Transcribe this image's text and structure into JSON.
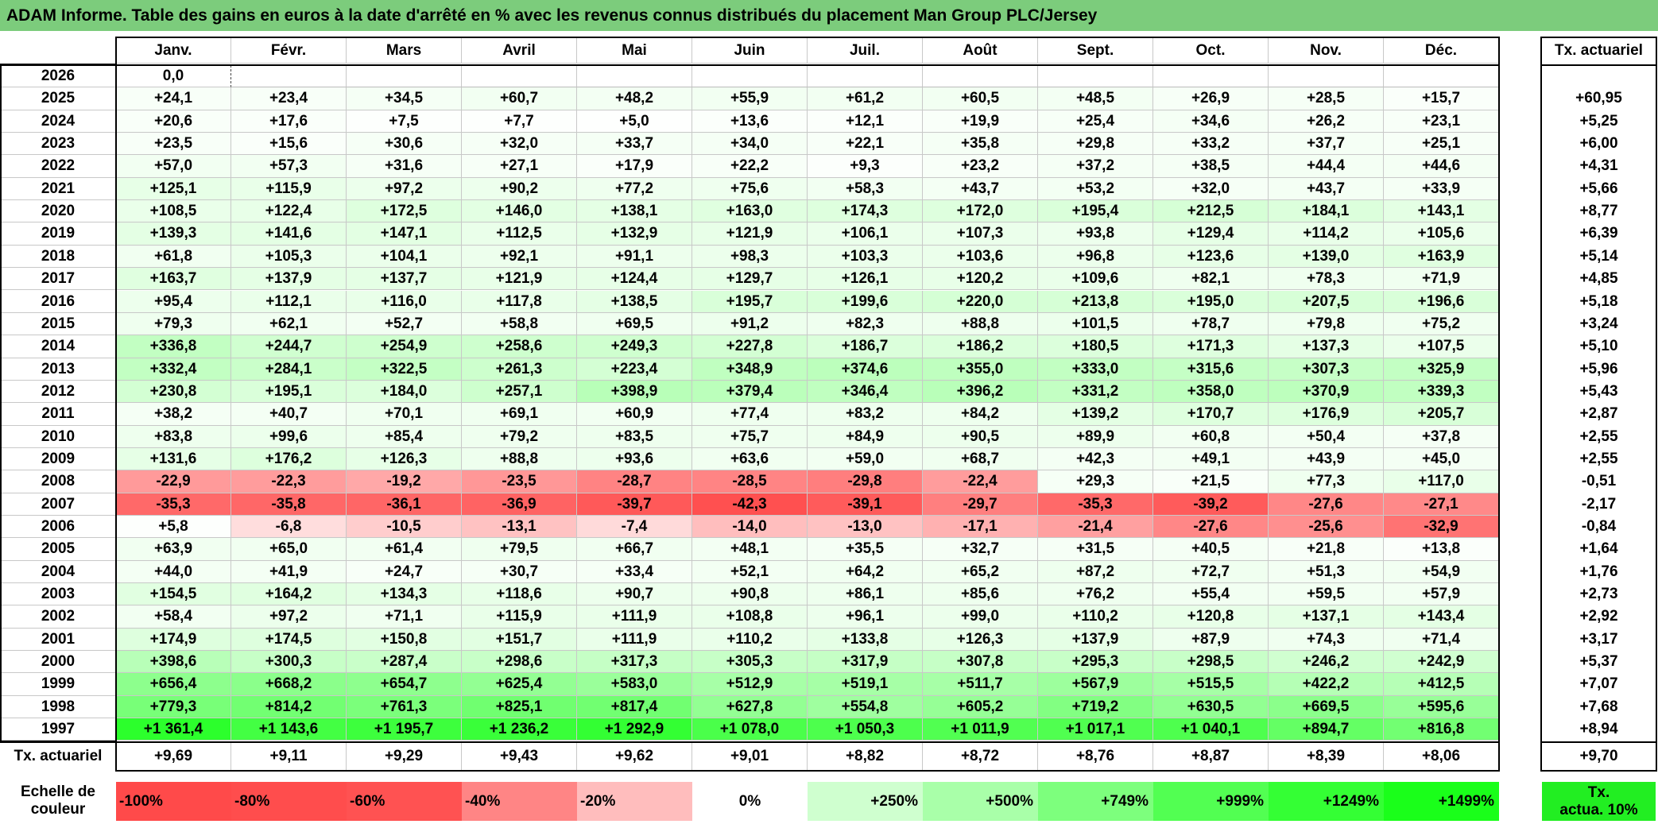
{
  "title": "ADAM Informe. Table des gains en euros à la date d'arrêté en % avec les revenus connus distribués du placement Man Group PLC/Jersey",
  "months": [
    "Janv.",
    "Févr.",
    "Mars",
    "Avril",
    "Mai",
    "Juin",
    "Juil.",
    "Août",
    "Sept.",
    "Oct.",
    "Nov.",
    "Déc."
  ],
  "rate_header": "Tx. actuariel",
  "rows": [
    {
      "year": "2026",
      "values": [
        "0,0",
        "",
        "",
        "",
        "",
        "",
        "",
        "",
        "",
        "",
        "",
        ""
      ],
      "rate": ""
    },
    {
      "year": "2025",
      "values": [
        "+24,1",
        "+23,4",
        "+34,5",
        "+60,7",
        "+48,2",
        "+55,9",
        "+61,2",
        "+60,5",
        "+48,5",
        "+26,9",
        "+28,5",
        "+15,7"
      ],
      "rate": "+60,95"
    },
    {
      "year": "2024",
      "values": [
        "+20,6",
        "+17,6",
        "+7,5",
        "+7,7",
        "+5,0",
        "+13,6",
        "+12,1",
        "+19,9",
        "+25,4",
        "+34,6",
        "+26,2",
        "+23,1"
      ],
      "rate": "+5,25"
    },
    {
      "year": "2023",
      "values": [
        "+23,5",
        "+15,6",
        "+30,6",
        "+32,0",
        "+33,7",
        "+34,0",
        "+22,1",
        "+35,8",
        "+29,8",
        "+33,2",
        "+37,7",
        "+25,1"
      ],
      "rate": "+6,00"
    },
    {
      "year": "2022",
      "values": [
        "+57,0",
        "+57,3",
        "+31,6",
        "+27,1",
        "+17,9",
        "+22,2",
        "+9,3",
        "+23,2",
        "+37,2",
        "+38,5",
        "+44,4",
        "+44,6"
      ],
      "rate": "+4,31"
    },
    {
      "year": "2021",
      "values": [
        "+125,1",
        "+115,9",
        "+97,2",
        "+90,2",
        "+77,2",
        "+75,6",
        "+58,3",
        "+43,7",
        "+53,2",
        "+32,0",
        "+43,7",
        "+33,9"
      ],
      "rate": "+5,66"
    },
    {
      "year": "2020",
      "values": [
        "+108,5",
        "+122,4",
        "+172,5",
        "+146,0",
        "+138,1",
        "+163,0",
        "+174,3",
        "+172,0",
        "+195,4",
        "+212,5",
        "+184,1",
        "+143,1"
      ],
      "rate": "+8,77"
    },
    {
      "year": "2019",
      "values": [
        "+139,3",
        "+141,6",
        "+147,1",
        "+112,5",
        "+132,9",
        "+121,9",
        "+106,1",
        "+107,3",
        "+93,8",
        "+129,4",
        "+114,2",
        "+105,6"
      ],
      "rate": "+6,39"
    },
    {
      "year": "2018",
      "values": [
        "+61,8",
        "+105,3",
        "+104,1",
        "+92,1",
        "+91,1",
        "+98,3",
        "+103,3",
        "+103,6",
        "+96,8",
        "+123,6",
        "+139,0",
        "+163,9"
      ],
      "rate": "+5,14"
    },
    {
      "year": "2017",
      "values": [
        "+163,7",
        "+137,9",
        "+137,7",
        "+121,9",
        "+124,4",
        "+129,7",
        "+126,1",
        "+120,2",
        "+109,6",
        "+82,1",
        "+78,3",
        "+71,9"
      ],
      "rate": "+4,85"
    },
    {
      "year": "2016",
      "values": [
        "+95,4",
        "+112,1",
        "+116,0",
        "+117,8",
        "+138,5",
        "+195,7",
        "+199,6",
        "+220,0",
        "+213,8",
        "+195,0",
        "+207,5",
        "+196,6"
      ],
      "rate": "+5,18"
    },
    {
      "year": "2015",
      "values": [
        "+79,3",
        "+62,1",
        "+52,7",
        "+58,8",
        "+69,5",
        "+91,2",
        "+82,3",
        "+88,8",
        "+101,5",
        "+78,7",
        "+79,8",
        "+75,2"
      ],
      "rate": "+3,24"
    },
    {
      "year": "2014",
      "values": [
        "+336,8",
        "+244,7",
        "+254,9",
        "+258,6",
        "+249,3",
        "+227,8",
        "+186,7",
        "+186,2",
        "+180,5",
        "+171,3",
        "+137,3",
        "+107,5"
      ],
      "rate": "+5,10"
    },
    {
      "year": "2013",
      "values": [
        "+332,4",
        "+284,1",
        "+322,5",
        "+261,3",
        "+223,4",
        "+348,9",
        "+374,6",
        "+355,0",
        "+333,0",
        "+315,6",
        "+307,3",
        "+325,9"
      ],
      "rate": "+5,96"
    },
    {
      "year": "2012",
      "values": [
        "+230,8",
        "+195,1",
        "+184,0",
        "+257,1",
        "+398,9",
        "+379,4",
        "+346,4",
        "+396,2",
        "+331,2",
        "+358,0",
        "+370,9",
        "+339,3"
      ],
      "rate": "+5,43"
    },
    {
      "year": "2011",
      "values": [
        "+38,2",
        "+40,7",
        "+70,1",
        "+69,1",
        "+60,9",
        "+77,4",
        "+83,2",
        "+84,2",
        "+139,2",
        "+170,7",
        "+176,9",
        "+205,7"
      ],
      "rate": "+2,87"
    },
    {
      "year": "2010",
      "values": [
        "+83,8",
        "+99,6",
        "+85,4",
        "+79,2",
        "+83,5",
        "+75,7",
        "+84,9",
        "+90,5",
        "+89,9",
        "+60,8",
        "+50,4",
        "+37,8"
      ],
      "rate": "+2,55"
    },
    {
      "year": "2009",
      "values": [
        "+131,6",
        "+176,2",
        "+126,3",
        "+88,8",
        "+93,6",
        "+63,6",
        "+59,0",
        "+68,7",
        "+42,3",
        "+49,1",
        "+43,9",
        "+45,0"
      ],
      "rate": "+2,55"
    },
    {
      "year": "2008",
      "values": [
        "-22,9",
        "-22,3",
        "-19,2",
        "-23,5",
        "-28,7",
        "-28,5",
        "-29,8",
        "-22,4",
        "+29,3",
        "+21,5",
        "+77,3",
        "+117,0"
      ],
      "rate": "-0,51"
    },
    {
      "year": "2007",
      "values": [
        "-35,3",
        "-35,8",
        "-36,1",
        "-36,9",
        "-39,7",
        "-42,3",
        "-39,1",
        "-29,7",
        "-35,3",
        "-39,2",
        "-27,6",
        "-27,1"
      ],
      "rate": "-2,17"
    },
    {
      "year": "2006",
      "values": [
        "+5,8",
        "-6,8",
        "-10,5",
        "-13,1",
        "-7,4",
        "-14,0",
        "-13,0",
        "-17,1",
        "-21,4",
        "-27,6",
        "-25,6",
        "-32,9"
      ],
      "rate": "-0,84"
    },
    {
      "year": "2005",
      "values": [
        "+63,9",
        "+65,0",
        "+61,4",
        "+79,5",
        "+66,7",
        "+48,1",
        "+35,5",
        "+32,7",
        "+31,5",
        "+40,5",
        "+21,8",
        "+13,8"
      ],
      "rate": "+1,64"
    },
    {
      "year": "2004",
      "values": [
        "+44,0",
        "+41,9",
        "+24,7",
        "+30,7",
        "+33,4",
        "+52,1",
        "+64,2",
        "+65,2",
        "+87,2",
        "+72,7",
        "+51,3",
        "+54,9"
      ],
      "rate": "+1,76"
    },
    {
      "year": "2003",
      "values": [
        "+154,5",
        "+164,2",
        "+134,3",
        "+118,6",
        "+90,7",
        "+90,8",
        "+86,1",
        "+85,6",
        "+76,2",
        "+55,4",
        "+59,5",
        "+57,9"
      ],
      "rate": "+2,73"
    },
    {
      "year": "2002",
      "values": [
        "+58,4",
        "+97,2",
        "+71,1",
        "+115,9",
        "+111,9",
        "+108,8",
        "+96,1",
        "+99,0",
        "+110,2",
        "+120,8",
        "+137,1",
        "+143,4"
      ],
      "rate": "+2,92"
    },
    {
      "year": "2001",
      "values": [
        "+174,9",
        "+174,5",
        "+150,8",
        "+151,7",
        "+111,9",
        "+110,2",
        "+133,8",
        "+126,3",
        "+137,9",
        "+87,9",
        "+74,3",
        "+71,4"
      ],
      "rate": "+3,17"
    },
    {
      "year": "2000",
      "values": [
        "+398,6",
        "+300,3",
        "+287,4",
        "+298,6",
        "+317,3",
        "+305,3",
        "+317,9",
        "+307,8",
        "+295,3",
        "+298,5",
        "+246,2",
        "+242,9"
      ],
      "rate": "+5,37"
    },
    {
      "year": "1999",
      "values": [
        "+656,4",
        "+668,2",
        "+654,7",
        "+625,4",
        "+583,0",
        "+512,9",
        "+519,1",
        "+511,7",
        "+567,9",
        "+515,5",
        "+422,2",
        "+412,5"
      ],
      "rate": "+7,07"
    },
    {
      "year": "1998",
      "values": [
        "+779,3",
        "+814,2",
        "+761,3",
        "+825,1",
        "+817,4",
        "+627,8",
        "+554,8",
        "+605,2",
        "+719,2",
        "+630,5",
        "+669,5",
        "+595,6"
      ],
      "rate": "+7,68"
    },
    {
      "year": "1997",
      "values": [
        "+1 361,4",
        "+1 143,6",
        "+1 195,7",
        "+1 236,2",
        "+1 292,9",
        "+1 078,0",
        "+1 050,3",
        "+1 011,9",
        "+1 017,1",
        "+1 040,1",
        "+894,7",
        "+816,8"
      ],
      "rate": "+8,94"
    }
  ],
  "footer": {
    "label": "Tx. actuariel",
    "values": [
      "+9,69",
      "+9,11",
      "+9,29",
      "+9,43",
      "+9,62",
      "+9,01",
      "+8,82",
      "+8,72",
      "+8,76",
      "+8,87",
      "+8,39",
      "+8,06"
    ],
    "rate": "+9,70"
  },
  "legend": {
    "label_line1": "Echelle de",
    "label_line2": "couleur",
    "items": [
      {
        "text": "-100%",
        "color": "#ff4a4a"
      },
      {
        "text": "-80%",
        "color": "#ff4d4d"
      },
      {
        "text": "-60%",
        "color": "#ff5252"
      },
      {
        "text": "-40%",
        "color": "#ff8585"
      },
      {
        "text": "-20%",
        "color": "#ffbdbd"
      },
      {
        "text": "0%",
        "color": "#ffffff"
      },
      {
        "text": "+250%",
        "color": "#cfffcf"
      },
      {
        "text": "+500%",
        "color": "#a9ffa9"
      },
      {
        "text": "+749%",
        "color": "#7dff7d"
      },
      {
        "text": "+999%",
        "color": "#52ff52"
      },
      {
        "text": "+1249%",
        "color": "#34ff34"
      },
      {
        "text": "+1499%",
        "color": "#1aff1a"
      }
    ],
    "rate_line1": "Tx.",
    "rate_line2": "actua. 10%",
    "rate_color": "#22ee22"
  }
}
